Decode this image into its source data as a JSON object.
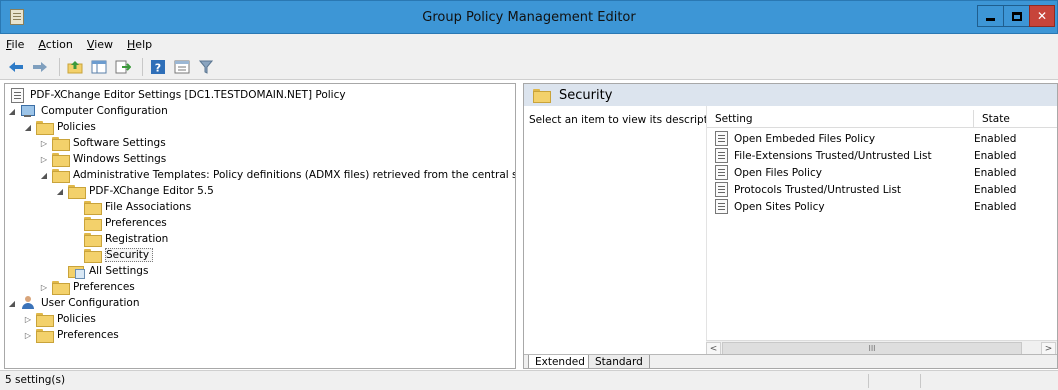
{
  "window": {
    "title": "Group Policy Management Editor",
    "title_bar_color": "#3d96d6",
    "close_color": "#c7443a"
  },
  "menu": [
    {
      "label": "File",
      "underline": "F",
      "rest": "ile"
    },
    {
      "label": "Action",
      "underline": "A",
      "rest": "ction"
    },
    {
      "label": "View",
      "underline": "V",
      "rest": "iew"
    },
    {
      "label": "Help",
      "underline": "H",
      "rest": "elp"
    }
  ],
  "toolbar": {
    "icons": [
      "back-arrow-icon",
      "forward-arrow-icon",
      "up-folder-icon",
      "show-hide-tree-icon",
      "export-list-icon",
      "help-icon",
      "properties-icon",
      "filter-icon"
    ]
  },
  "tree": {
    "root": "PDF-XChange Editor Settings [DC1.TESTDOMAIN.NET] Policy",
    "computer_configuration": "Computer Configuration",
    "policies": "Policies",
    "software_settings": "Software Settings",
    "windows_settings": "Windows Settings",
    "administrative_templates": "Administrative Templates: Policy definitions (ADMX files) retrieved from the central store.",
    "pdf_xchange_editor": "PDF-XChange Editor 5.5",
    "file_associations": "File Associations",
    "preferences_sub": "Preferences",
    "registration": "Registration",
    "security": "Security",
    "all_settings": "All Settings",
    "computer_preferences": "Preferences",
    "user_configuration": "User Configuration",
    "user_policies": "Policies",
    "user_preferences": "Preferences"
  },
  "details": {
    "header_title": "Security",
    "description": "Select an item to view its description.",
    "columns": {
      "setting": "Setting",
      "state": "State"
    },
    "rows": [
      {
        "setting": "Open Embeded Files Policy",
        "state": "Enabled"
      },
      {
        "setting": "File-Extensions Trusted/Untrusted List",
        "state": "Enabled"
      },
      {
        "setting": "Open Files Policy",
        "state": "Enabled"
      },
      {
        "setting": "Protocols Trusted/Untrusted List",
        "state": "Enabled"
      },
      {
        "setting": "Open Sites Policy",
        "state": "Enabled"
      }
    ],
    "scroll_left": "<",
    "scroll_thumb": "III",
    "scroll_right": ">",
    "tabs": {
      "extended": "Extended",
      "standard": "Standard"
    }
  },
  "status": {
    "text": "5 setting(s)"
  }
}
